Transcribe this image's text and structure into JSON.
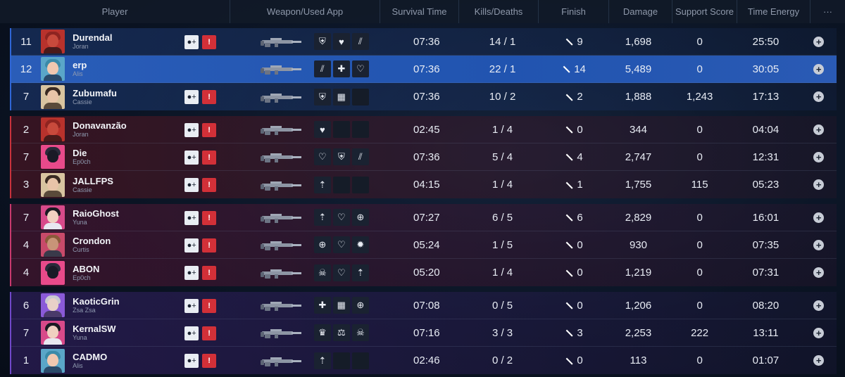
{
  "header": {
    "player": "Player",
    "weapon": "Weapon/Used App",
    "survival": "Survival Time",
    "kd": "Kills/Deaths",
    "finish": "Finish",
    "damage": "Damage",
    "support": "Support Score",
    "energy": "Time Energy",
    "more": "···"
  },
  "colors": {
    "team_blue": "#2f66d6",
    "team_red": "#c8323c",
    "team_pink": "#c83a6e",
    "team_purple": "#7048c8",
    "report": "#d23038",
    "highlight": "#2154b0"
  },
  "teams": [
    {
      "color": "blue",
      "rows": [
        {
          "level": "11",
          "name": "Durendal",
          "char": "Joran",
          "survival": "07:36",
          "kd": "14 / 1",
          "finish": "9",
          "damage": "1,698",
          "support": "0",
          "energy": "25:50",
          "apps": [
            "shield-icon",
            "heart-icon",
            "slash-icon"
          ],
          "self": false
        },
        {
          "level": "12",
          "name": "erp",
          "char": "Alis",
          "survival": "07:36",
          "kd": "22 / 1",
          "finish": "14",
          "damage": "5,489",
          "support": "0",
          "energy": "30:05",
          "apps": [
            "slash-icon",
            "cross-plus-icon",
            "heart-shield-icon"
          ],
          "self": true
        },
        {
          "level": "7",
          "name": "Zubumafu",
          "char": "Cassie",
          "survival": "07:36",
          "kd": "10 / 2",
          "finish": "2",
          "damage": "1,888",
          "support": "1,243",
          "energy": "17:13",
          "apps": [
            "shield-icon",
            "grid-icon",
            ""
          ],
          "self": false
        }
      ]
    },
    {
      "color": "red",
      "rows": [
        {
          "level": "2",
          "name": "Donavanzão",
          "char": "Joran",
          "survival": "02:45",
          "kd": "1 / 4",
          "finish": "0",
          "damage": "344",
          "support": "0",
          "energy": "04:04",
          "apps": [
            "heart-icon",
            "",
            ""
          ],
          "self": false
        },
        {
          "level": "7",
          "name": "Die",
          "char": "Ep0ch",
          "survival": "07:36",
          "kd": "5 / 4",
          "finish": "4",
          "damage": "2,747",
          "support": "0",
          "energy": "12:31",
          "apps": [
            "heart-shield-icon",
            "shield-icon",
            "slash-icon"
          ],
          "self": false
        },
        {
          "level": "3",
          "name": "JALLFPS",
          "char": "Cassie",
          "survival": "04:15",
          "kd": "1 / 4",
          "finish": "1",
          "damage": "1,755",
          "support": "115",
          "energy": "05:23",
          "apps": [
            "arrow-target-icon",
            "",
            ""
          ],
          "self": false
        }
      ]
    },
    {
      "color": "pink",
      "rows": [
        {
          "level": "7",
          "name": "RaioGhost",
          "char": "Yuna",
          "survival": "07:27",
          "kd": "6 / 5",
          "finish": "6",
          "damage": "2,829",
          "support": "0",
          "energy": "16:01",
          "apps": [
            "arrow-target-icon",
            "heart-shield-icon",
            "crosshair-icon"
          ],
          "self": false
        },
        {
          "level": "4",
          "name": "Crondon",
          "char": "Curtis",
          "survival": "05:24",
          "kd": "1 / 5",
          "finish": "0",
          "damage": "930",
          "support": "0",
          "energy": "07:35",
          "apps": [
            "crosshair-icon",
            "heart-shield-icon",
            "burst-icon"
          ],
          "self": false
        },
        {
          "level": "4",
          "name": "ABON",
          "char": "Ep0ch",
          "survival": "05:20",
          "kd": "1 / 4",
          "finish": "0",
          "damage": "1,219",
          "support": "0",
          "energy": "07:31",
          "apps": [
            "skull-icon",
            "heart-shield-icon",
            "arrow-target-icon"
          ],
          "self": false
        }
      ]
    },
    {
      "color": "purple",
      "rows": [
        {
          "level": "6",
          "name": "KaoticGrin",
          "char": "Zsa Zsa",
          "survival": "07:08",
          "kd": "0 / 5",
          "finish": "0",
          "damage": "1,206",
          "support": "0",
          "energy": "08:20",
          "apps": [
            "cross-plus-icon",
            "grid-icon",
            "crosshair-icon"
          ],
          "self": false
        },
        {
          "level": "7",
          "name": "KernalSW",
          "char": "Yuna",
          "survival": "07:16",
          "kd": "3 / 3",
          "finish": "3",
          "damage": "2,253",
          "support": "222",
          "energy": "13:11",
          "apps": [
            "crown-icon",
            "scales-icon",
            "skull-icon"
          ],
          "self": false
        },
        {
          "level": "1",
          "name": "CADMO",
          "char": "Alis",
          "survival": "02:46",
          "kd": "0 / 2",
          "finish": "0",
          "damage": "113",
          "support": "0",
          "energy": "01:07",
          "apps": [
            "arrow-target-icon",
            "",
            ""
          ],
          "self": false
        }
      ]
    }
  ]
}
